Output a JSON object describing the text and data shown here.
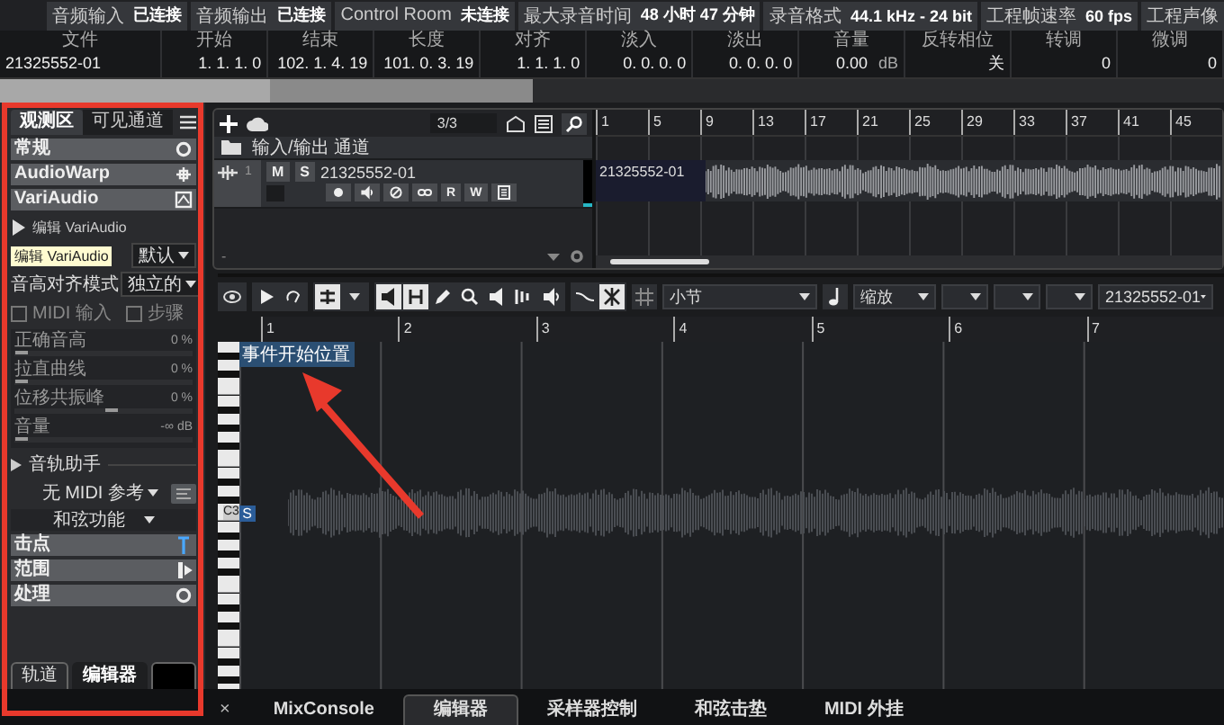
{
  "status_bar": [
    {
      "label": "音频输入",
      "value": "已连接"
    },
    {
      "label": "音频输出",
      "value": "已连接"
    },
    {
      "label": "Control Room",
      "value": "未连接"
    },
    {
      "label": "最大录音时间",
      "value": "48 小时 47 分钟"
    },
    {
      "label": "录音格式",
      "value": "44.1 kHz - 24 bit"
    },
    {
      "label": "工程帧速率",
      "value": "60 fps"
    },
    {
      "label": "工程声像"
    }
  ],
  "info_line": [
    {
      "header": "文件",
      "value": "21325552-01"
    },
    {
      "header": "开始",
      "value": "1. 1. 1. 0"
    },
    {
      "header": "结束",
      "value": "102. 1. 4. 19"
    },
    {
      "header": "长度",
      "value": "101. 0. 3. 19"
    },
    {
      "header": "对齐",
      "value": "1. 1. 1. 0"
    },
    {
      "header": "淡入",
      "value": "0. 0. 0. 0"
    },
    {
      "header": "淡出",
      "value": "0. 0. 0. 0"
    },
    {
      "header": "音量",
      "value": "0.00",
      "unit": "dB"
    },
    {
      "header": "反转相位",
      "value": "关"
    },
    {
      "header": "转调",
      "value": "0"
    },
    {
      "header": "微调",
      "value": "0"
    }
  ],
  "inspector": {
    "tabs": [
      {
        "label": "观测区",
        "selected": true
      },
      {
        "label": "可见通道",
        "selected": false
      }
    ],
    "sections": [
      {
        "title": "常规"
      },
      {
        "title": "AudioWarp"
      },
      {
        "title": "VariAudio"
      }
    ],
    "variaudio": {
      "edit_label": "编辑 VariAudio",
      "tooltip": "编辑 VariAudio",
      "preset": "默认",
      "pitch_mode_label": "音高对齐模式",
      "pitch_mode": "独立的",
      "checkboxes": [
        {
          "label": "MIDI 输入",
          "checked": false
        },
        {
          "label": "步骤",
          "checked": false
        }
      ],
      "sliders": [
        {
          "label": "正确音高",
          "reading": "0 %",
          "level": 0
        },
        {
          "label": "拉直曲线",
          "reading": "0 %",
          "level": 0
        },
        {
          "label": "位移共振峰",
          "reading": "0 %",
          "level": 0.5
        },
        {
          "label": "音量",
          "reading": "-∞ dB",
          "level": 0
        }
      ]
    },
    "track_assistant": {
      "label": "音轨助手",
      "expanded": false,
      "midi_reference": "无 MIDI 参考",
      "chord_function": "和弦功能"
    },
    "lower_sections": [
      {
        "title": "击点"
      },
      {
        "title": "范围"
      },
      {
        "title": "处理"
      }
    ],
    "bottom_tabs": [
      {
        "label": "轨道",
        "selected": false
      },
      {
        "label": "编辑器",
        "selected": true
      }
    ]
  },
  "project": {
    "track_count": "3/3",
    "footer": "-",
    "tracks": [
      {
        "kind": "folder",
        "name": "输入/输出 通道"
      },
      {
        "kind": "audio",
        "number": "1",
        "name": "21325552-01",
        "mute": "M",
        "solo": "S",
        "read": "R",
        "write": "W"
      }
    ],
    "ruler": [
      "1",
      "5",
      "9",
      "13",
      "17",
      "21",
      "25",
      "29",
      "33",
      "37",
      "41",
      "45"
    ],
    "event": "21325552-01"
  },
  "editor": {
    "grid_type": "小节",
    "zoom_mode": "缩放",
    "clip": "21325552-01",
    "ruler": [
      "1",
      "2",
      "3",
      "4",
      "5",
      "6",
      "7"
    ],
    "event_start": "事件开始位置",
    "key_label": "C3",
    "marker": "S"
  },
  "lower_zone": {
    "close": "×",
    "tabs": [
      {
        "label": "MixConsole",
        "selected": false
      },
      {
        "label": "编辑器",
        "selected": true
      },
      {
        "label": "采样器控制",
        "selected": false
      },
      {
        "label": "和弦击垫",
        "selected": false
      },
      {
        "label": "MIDI 外挂",
        "selected": false
      }
    ]
  }
}
